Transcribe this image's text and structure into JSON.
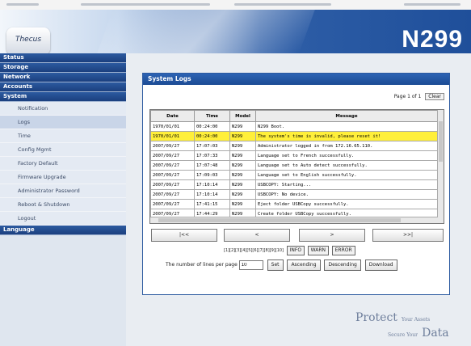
{
  "header": {
    "logo_text": "Thecus",
    "model": "N299"
  },
  "sidebar": {
    "sections": [
      {
        "label": "Status"
      },
      {
        "label": "Storage"
      },
      {
        "label": "Network"
      },
      {
        "label": "Accounts"
      },
      {
        "label": "System"
      }
    ],
    "system_items": [
      {
        "label": "Notification"
      },
      {
        "label": "Logs"
      },
      {
        "label": "Time"
      },
      {
        "label": "Config Mgmt"
      },
      {
        "label": "Factory Default"
      },
      {
        "label": "Firmware Upgrade"
      },
      {
        "label": "Administrator Password"
      },
      {
        "label": "Reboot & Shutdown"
      },
      {
        "label": "Logout"
      }
    ],
    "language_label": "Language"
  },
  "panel": {
    "title": "System Logs",
    "page_label": "Page 1 of 1",
    "page_select": "Clear",
    "columns": [
      "Date",
      "Time",
      "Model",
      "Message"
    ],
    "rows": [
      {
        "date": "1970/01/01",
        "time": "00:24:00",
        "model": "N299",
        "message": "N299 Boot."
      },
      {
        "date": "1970/01/01",
        "time": "00:24:00",
        "model": "N299",
        "message": "The system's time is invalid, please reset it!"
      },
      {
        "date": "2007/09/27",
        "time": "17:07:03",
        "model": "N299",
        "message": "Administrator logged in from 172.16.65.110."
      },
      {
        "date": "2007/09/27",
        "time": "17:07:33",
        "model": "N299",
        "message": "Language set to French successfully."
      },
      {
        "date": "2007/09/27",
        "time": "17:07:48",
        "model": "N299",
        "message": "Language set to Auto detect successfully."
      },
      {
        "date": "2007/09/27",
        "time": "17:09:03",
        "model": "N299",
        "message": "Language set to English successfully."
      },
      {
        "date": "2007/09/27",
        "time": "17:10:14",
        "model": "N299",
        "message": "USBCOPY: Starting..."
      },
      {
        "date": "2007/09/27",
        "time": "17:10:14",
        "model": "N299",
        "message": "USBCOPY: No device."
      },
      {
        "date": "2007/09/27",
        "time": "17:41:15",
        "model": "N299",
        "message": "Eject folder USBCopy successfully."
      },
      {
        "date": "2007/09/27",
        "time": "17:44:29",
        "model": "N299",
        "message": "Create folder USBCopy successfully."
      }
    ],
    "nav": {
      "first": "|<<",
      "prev": "<",
      "next": ">",
      "last": ">>|"
    },
    "filter_prefix": "[1][2][3][4][5][6][7][8][9][10]",
    "filters": [
      "INFO",
      "WARN",
      "ERROR"
    ],
    "lines_label": "The number of lines per page",
    "lines_value": "10",
    "set_label": "Set",
    "sort_asc": "Ascending",
    "sort_desc": "Descending",
    "download": "Download"
  },
  "tagline": {
    "line1": "Protect",
    "line2": "Your Assets",
    "line3": "Secure Your",
    "line4": "Data"
  }
}
